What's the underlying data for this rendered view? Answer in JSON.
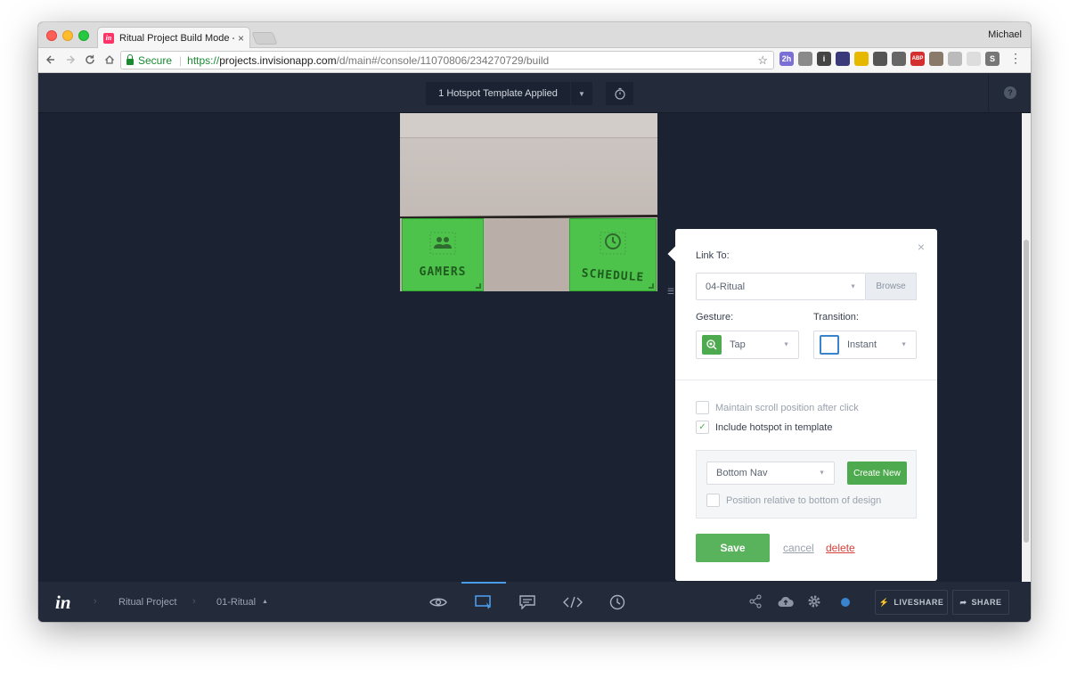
{
  "browser": {
    "tab_title": "Ritual Project Build Mode - InV",
    "tab_close": "×",
    "favicon_text": "in",
    "profile_name": "Michael",
    "secure_label": "Secure",
    "url_scheme": "https://",
    "url_host": "projects.invisionapp.com",
    "url_path": "/d/main#/console/11070806/234270729/build",
    "extensions": [
      {
        "icon": "calendar-icon",
        "text": "2h",
        "color": "#7a6fd6"
      },
      {
        "icon": "tools-icon",
        "text": "",
        "color": "#8a8a8a"
      },
      {
        "icon": "info-icon",
        "text": "i",
        "color": "#444444"
      },
      {
        "icon": "reader-icon",
        "text": "",
        "color": "#3a3a7a"
      },
      {
        "icon": "chrome-ext-icon",
        "text": "",
        "color": "#e6b800"
      },
      {
        "icon": "pen-icon",
        "text": "",
        "color": "#555555"
      },
      {
        "icon": "plane-icon",
        "text": "",
        "color": "#666666"
      },
      {
        "icon": "abp-icon",
        "text": "ABP",
        "color": "#d32f2f"
      },
      {
        "icon": "bookmark-icon",
        "text": "",
        "color": "#8a7a6a"
      },
      {
        "icon": "window-icon",
        "text": "",
        "color": "#bbbbbb"
      },
      {
        "icon": "feather-icon",
        "text": "",
        "color": "#dddddd"
      },
      {
        "icon": "s-icon",
        "text": "S",
        "color": "#777777"
      }
    ]
  },
  "appbar": {
    "template_label": "1 Hotspot Template Applied",
    "help_label": "?"
  },
  "design": {
    "hotspot_left_label": "GAMERS",
    "hotspot_right_label": "SCHEDULE"
  },
  "popover": {
    "link_to_label": "Link To:",
    "link_to_value": "04-Ritual",
    "browse_label": "Browse",
    "gesture_label": "Gesture:",
    "gesture_value": "Tap",
    "transition_label": "Transition:",
    "transition_value": "Instant",
    "maintain_scroll_label": "Maintain scroll position after click",
    "maintain_scroll_checked": false,
    "include_template_label": "Include hotspot in template",
    "include_template_checked": true,
    "template_value": "Bottom Nav",
    "create_new_label": "Create New",
    "position_relative_label": "Position relative to bottom of design",
    "position_relative_checked": false,
    "save_label": "Save",
    "cancel_label": "cancel",
    "delete_label": "delete",
    "close_label": "×",
    "check_mark": "✓"
  },
  "bottombar": {
    "logo": "in",
    "breadcrumb_project": "Ritual Project",
    "breadcrumb_screen": "01-Ritual",
    "liveshare_label": "LIVESHARE",
    "share_label": "SHARE",
    "status_color": "#3a83cd"
  },
  "colors": {
    "canvas_bg": "#1b2232",
    "bar_bg": "#232b3b",
    "accent_green": "#59b25c",
    "accent_blue": "#4a9be8",
    "delete_red": "#d9403a"
  }
}
